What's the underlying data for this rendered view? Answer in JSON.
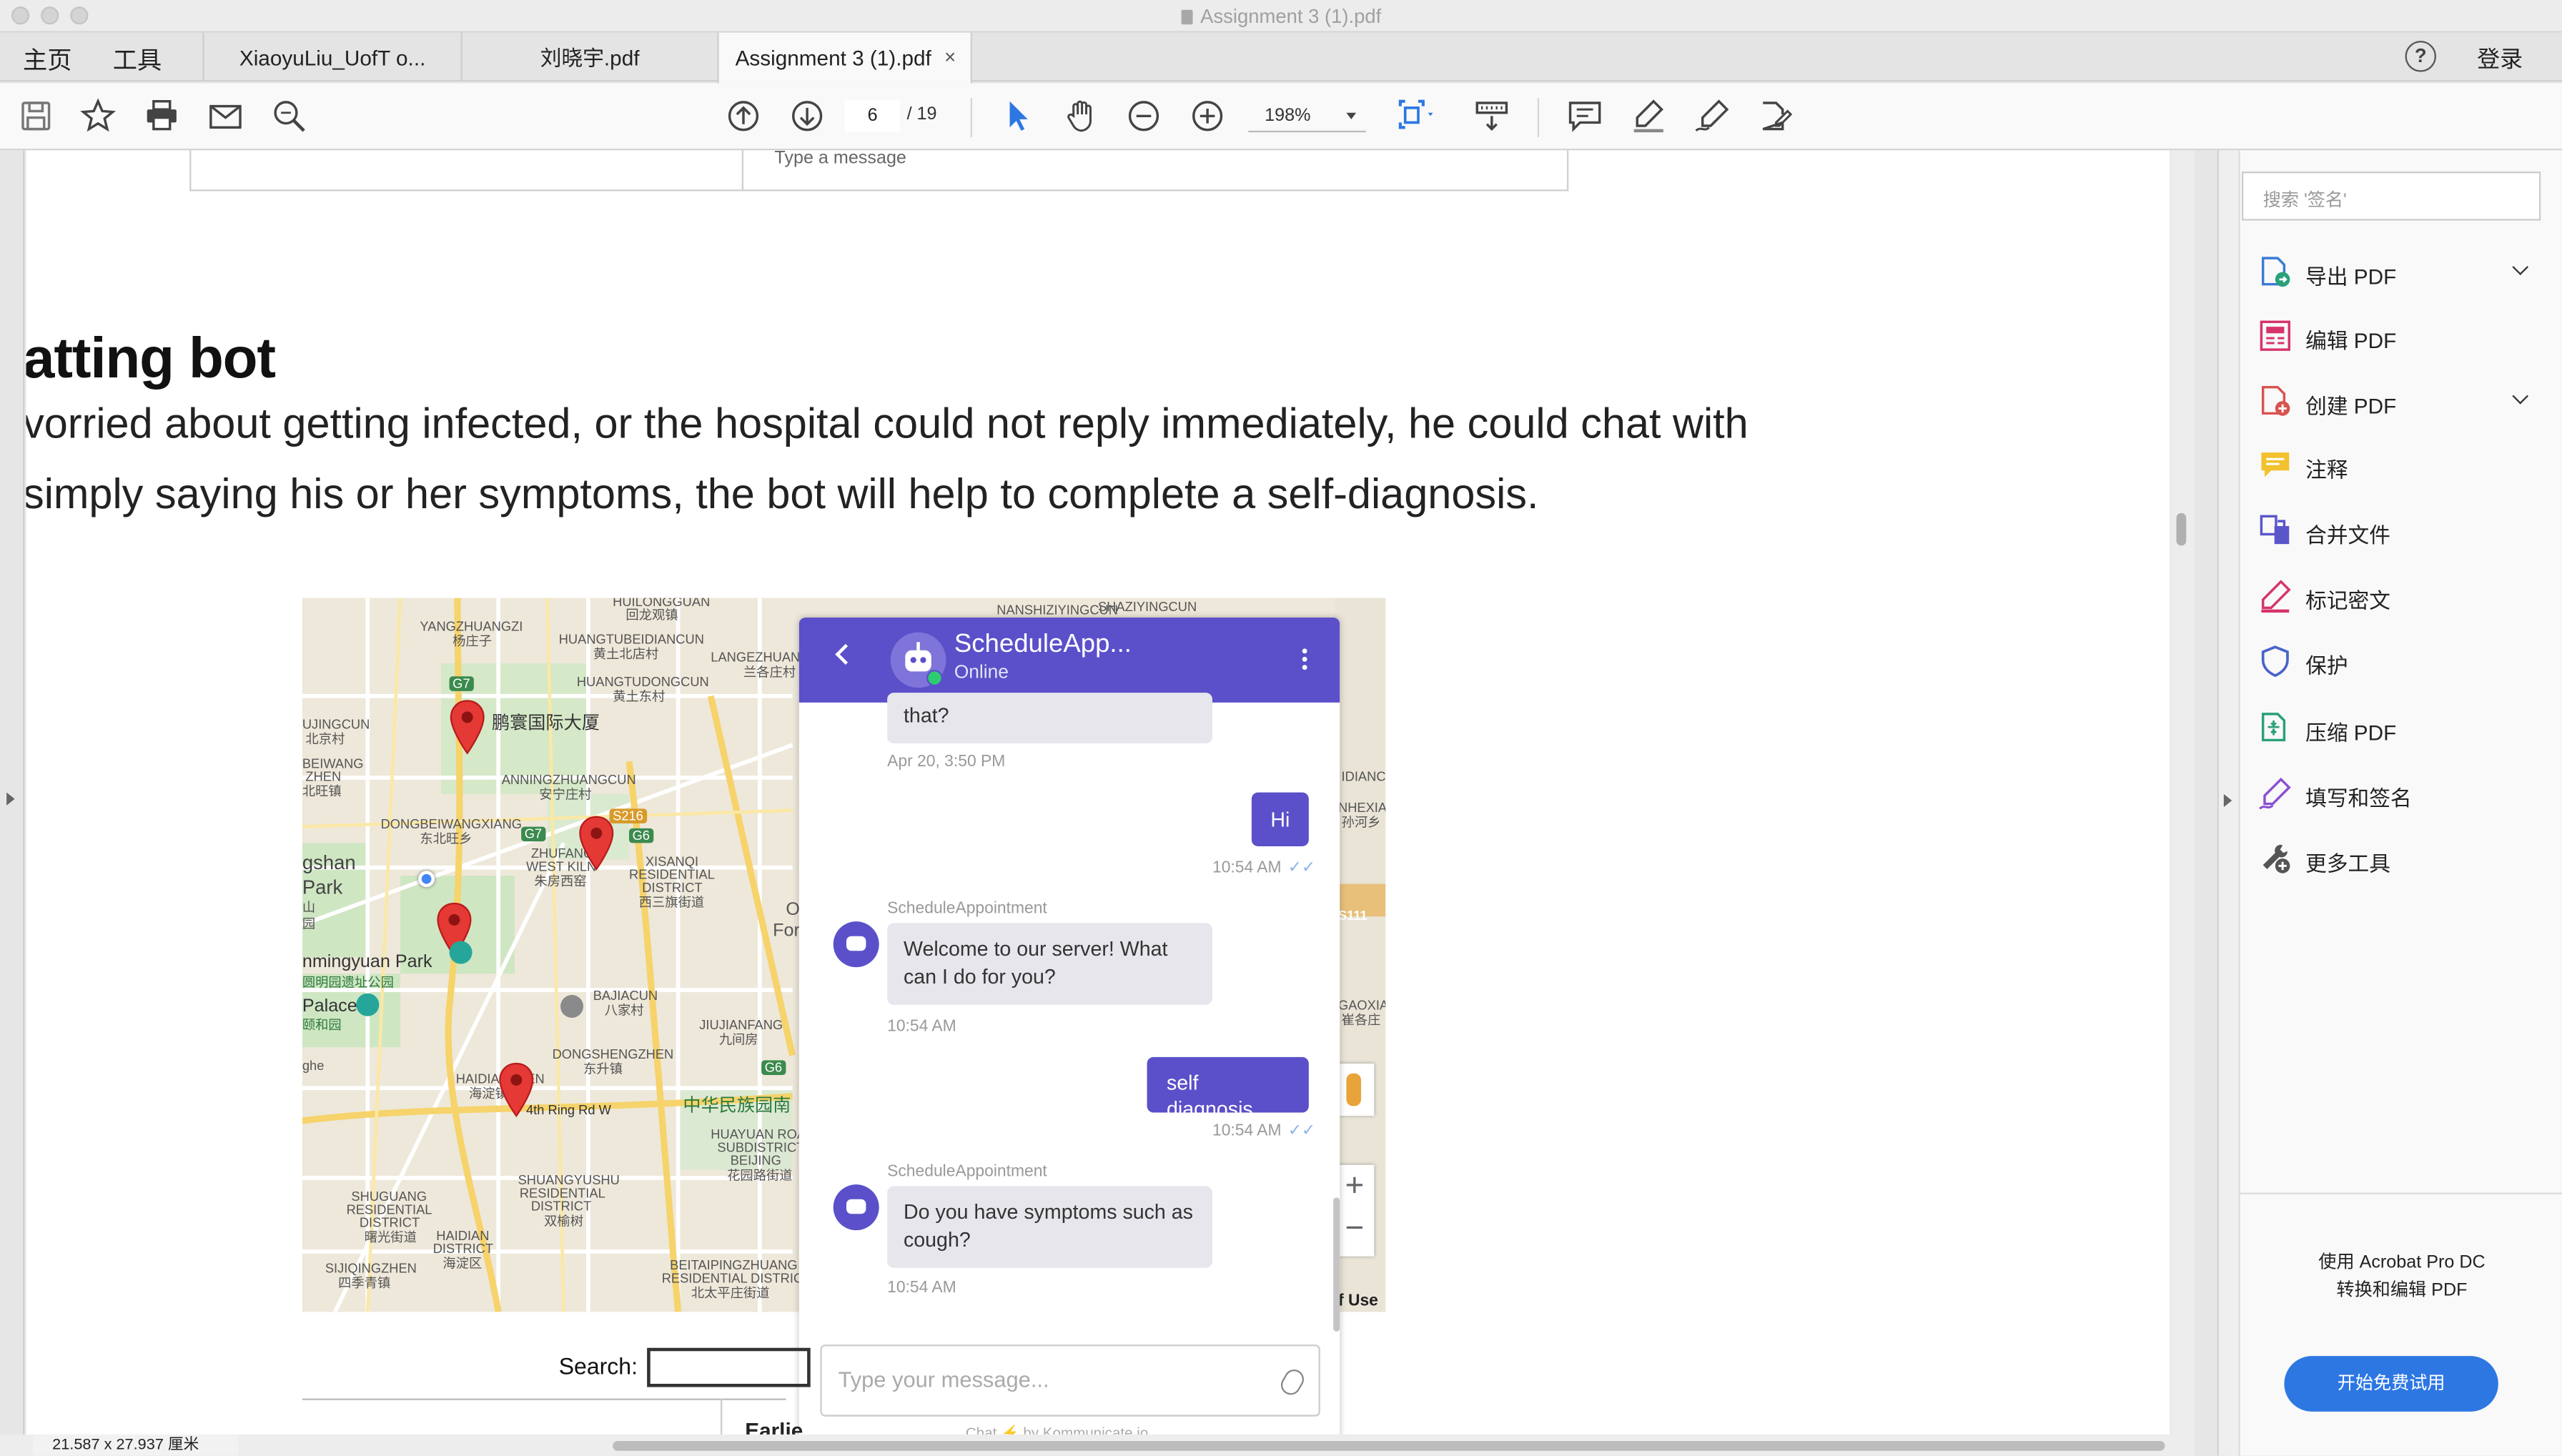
{
  "window": {
    "title": "Assignment 3 (1).pdf"
  },
  "menu": {
    "home": "主页",
    "tools": "工具",
    "login": "登录"
  },
  "tabs": [
    {
      "label": "XiaoyuLiu_UofT o..."
    },
    {
      "label": "刘晓宇.pdf"
    },
    {
      "label": "Assignment 3 (1).pdf",
      "close": "×"
    }
  ],
  "toolbar": {
    "page_current": "6",
    "page_total": "/ 19",
    "zoom": "198%"
  },
  "document": {
    "message_placeholder": "Type a message",
    "heading": "atting bot",
    "para_line1": "vorried about getting infected, or the hospital could not reply immediately, he could chat with",
    "para_line2": "simply saying his or her symptoms, the bot will help to complete a self-diagnosis.",
    "search_label": "Search:",
    "table_header_partial": "Earlie",
    "dimensions": "21.587 x 27.937 厘米"
  },
  "map": {
    "labels": {
      "yangzhuangzi": "YANGZHUANGZI",
      "yangzhuangzi_cn": "杨庄子",
      "huangtubei": "HUANGTUBEIDIANCUN",
      "huangtubei_cn": "黄土北店村",
      "huangtudong": "HUANGTUDONGCUN",
      "huangtudong_cn": "黄土东村",
      "langezhuang": "LANGEZHUANG",
      "langezhuang_cn": "兰各庄村",
      "ujingcun": "UJINGCUN",
      "ujingcun_cn": "北京村",
      "pengrun": "鹏寰国际大厦",
      "beiwang": "BEIWANG",
      "zhen": "ZHEN",
      "beiwang_cn": "北旺镇",
      "anningzhuang": "ANNINGZHUANGCUN",
      "anningzhuang_cn": "安宁庄村",
      "dongbeiwang": "DONGBEIWANGXIANG",
      "dongbeiwang_cn": "东北旺乡",
      "zhufang": "ZHUFANG",
      "westkiln": "WEST KILN",
      "zhufang_cn": "朱房西窑",
      "xisanqi": "XISANQI",
      "residential": "RESIDENTIAL",
      "district": "DISTRICT",
      "xisanqi_cn": "西三旗街道",
      "ghsan": "gshan",
      "park": "Park",
      "shan_cn": "山",
      "yuan_cn": "园",
      "yuanmingyuan": "nmingyuan Park",
      "yuanmingyuan_cn": "圆明园遗址公园",
      "palace": "Palace",
      "palace_cn": "颐和园",
      "bajiacun": "BAJIACUN",
      "bajiacun_cn": "八家村",
      "jiujianfang": "JIUJIANFANG",
      "jiujianfang_cn": "九间房",
      "dongsheng": "DONGSHENGZHEN",
      "dongsheng_cn": "东升镇",
      "ghe": "ghe",
      "haidianzhen": "HAIDIANZHEN",
      "haidianzhen_cn": "海淀镇",
      "ring": "4th Ring Rd W",
      "minzu": "中华民族园南",
      "shuangyushu": "SHUANGYUSHU",
      "shuangyushu_res": "RESIDENTIAL",
      "shuangyushu_dist": "DISTRICT",
      "shuangyushu_cn": "双榆树",
      "huayuanroad": "HUAYUAN ROAD",
      "subdistrict": "SUBDISTRICT,",
      "beijing": "BEIJING",
      "huayuan_cn": "花园路街道",
      "shuguang": "SHUGUANG",
      "shuguang_res": "RESIDENTIAL",
      "shuguang_dist": "DISTRICT",
      "shuguang_cn": "曙光街道",
      "haidian": "HAIDIAN",
      "haidian_dist": "DISTRICT",
      "haidian_cn": "海淀区",
      "sijiqing": "SIJIQINGZHEN",
      "sijiqing_cn": "四季青镇",
      "beitaiping": "BEITAIPINGZHUANG",
      "beitaiping_res": "RESIDENTIAL DISTRICT",
      "beitaiping_cn": "北太平庄街道",
      "nanshi": "NANSHIZIYINGCUN",
      "shazi": "SHAZIYINGCUN",
      "hui": "HUILONGGUAN",
      "hui_cn": "回龙观镇",
      "o_partial": "O",
      "for_partial": "For",
      "idianc": "IDIANC",
      "nhexia": "NHEXIA",
      "shenjia_cn": "孙河乡",
      "gaoxia": "GAOXIA",
      "gaoxia_cn": "崔各庄",
      "s111": "S111",
      "road_g7": "G7",
      "road_g7b": "G7",
      "road_s216": "S216",
      "road_g6": "G6",
      "road_g6b": "G6",
      "terms": "f Use"
    }
  },
  "chat": {
    "title": "ScheduleApp...",
    "status": "Online",
    "msg0": "that?",
    "ts0": "Apr 20, 3:50 PM",
    "out1": "Hi",
    "ts1": "10:54 AM",
    "sender": "ScheduleAppointment",
    "in1": "Welcome to our server! What can I do for you?",
    "ts2": "10:54 AM",
    "out2": "self diagnosis",
    "ts3": "10:54 AM",
    "sender2": "ScheduleAppointment",
    "in2": "Do you have symptoms such as cough?",
    "ts4": "10:54 AM",
    "input_placeholder": "Type your message...",
    "footer": "Chat ⚡ by Kommunicate.io",
    "ticks": "✓✓"
  },
  "right_panel": {
    "search_placeholder": "搜索 '签名'",
    "tools": [
      {
        "label": "导出 PDF",
        "icon": "export-pdf-icon"
      },
      {
        "label": "编辑 PDF",
        "icon": "edit-pdf-icon"
      },
      {
        "label": "创建 PDF",
        "icon": "create-pdf-icon"
      },
      {
        "label": "注释",
        "icon": "comment-icon"
      },
      {
        "label": "合并文件",
        "icon": "combine-files-icon"
      },
      {
        "label": "标记密文",
        "icon": "redact-icon"
      },
      {
        "label": "保护",
        "icon": "protect-icon"
      },
      {
        "label": "压缩 PDF",
        "icon": "compress-pdf-icon"
      },
      {
        "label": "填写和签名",
        "icon": "fill-sign-icon"
      },
      {
        "label": "更多工具",
        "icon": "more-tools-icon"
      }
    ],
    "promo_line1": "使用 Acrobat Pro DC",
    "promo_line2": "转换和编辑 PDF",
    "trial_button": "开始免费试用"
  },
  "colors": {
    "chat_header": "#5b50c9",
    "trial_button": "#2d77e3",
    "pin_red": "#e53935",
    "map_bg": "#efe9dc",
    "map_park": "#cfe6c3",
    "map_road_yellow": "#f6d36b"
  }
}
